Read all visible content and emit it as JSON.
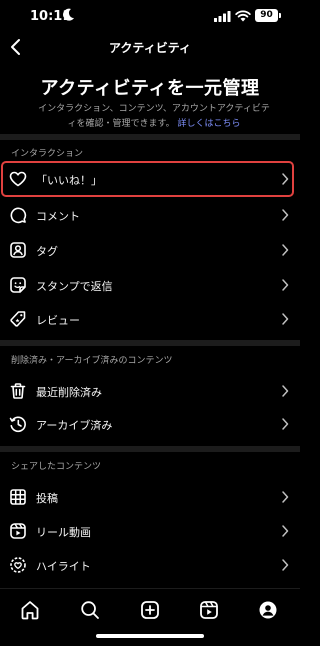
{
  "status_bar": {
    "time": "10:11",
    "battery": "90"
  },
  "header": {
    "title": "アクティビティ"
  },
  "hero": {
    "title": "アクティビティを一元管理",
    "description": "インタラクション、コンテンツ、アカウントアクティビティを確認・管理できます。",
    "link": "詳しくはこちら"
  },
  "sections": [
    {
      "label": "インタラクション",
      "items": [
        {
          "label": "「いいね！」",
          "icon": "heart-icon"
        },
        {
          "label": "コメント",
          "icon": "comment-icon"
        },
        {
          "label": "タグ",
          "icon": "tag-icon"
        },
        {
          "label": "スタンプで返信",
          "icon": "sticker-icon"
        },
        {
          "label": "レビュー",
          "icon": "review-icon"
        }
      ]
    },
    {
      "label": "削除済み・アーカイブ済みのコンテンツ",
      "items": [
        {
          "label": "最近削除済み",
          "icon": "trash-icon"
        },
        {
          "label": "アーカイブ済み",
          "icon": "archive-icon"
        }
      ]
    },
    {
      "label": "シェアしたコンテンツ",
      "items": [
        {
          "label": "投稿",
          "icon": "grid-icon"
        },
        {
          "label": "リール動画",
          "icon": "reels-icon"
        },
        {
          "label": "ハイライト",
          "icon": "highlight-icon"
        }
      ]
    }
  ],
  "tab_bar": [
    "home-icon",
    "search-icon",
    "create-icon",
    "reels-icon",
    "profile-icon"
  ],
  "colors": {
    "background": "#000000",
    "highlight_border": "#e0413f",
    "link": "#7b8cf5"
  }
}
